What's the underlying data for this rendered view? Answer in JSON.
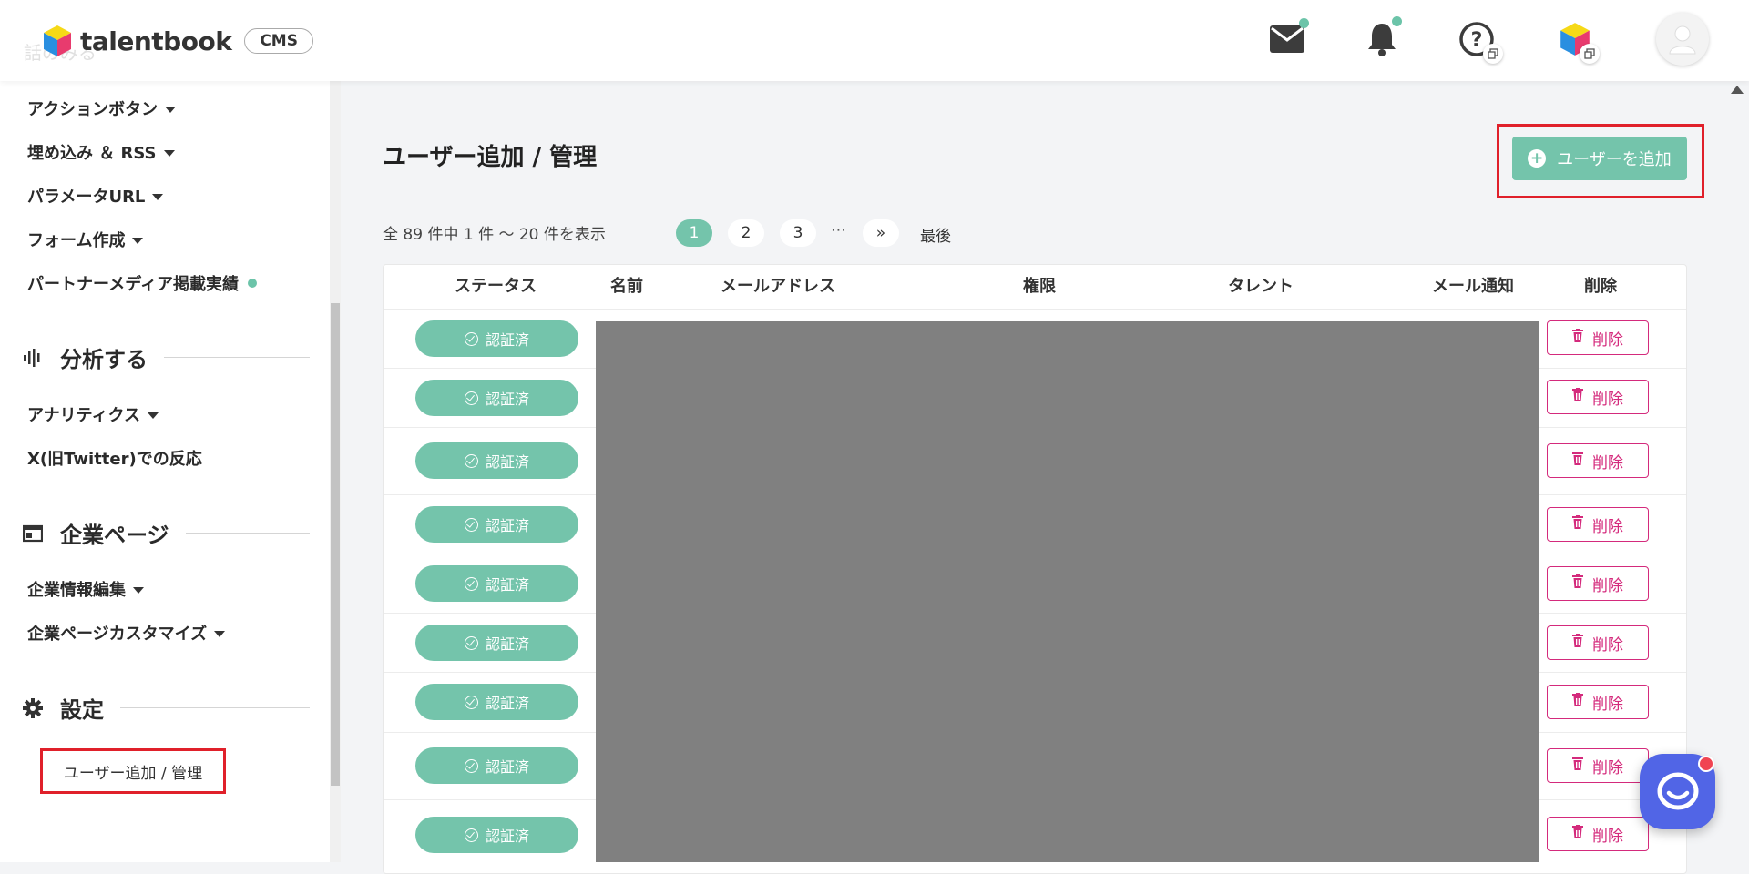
{
  "header": {
    "logo_text": "talentbook",
    "cms_badge": "CMS",
    "faded_text": "話のみる"
  },
  "sidebar": {
    "items_top": [
      {
        "label": "アクションボタン",
        "caret": true
      },
      {
        "label": "埋め込み ＆ RSS",
        "caret": true
      },
      {
        "label": "パラメータURL",
        "caret": true
      },
      {
        "label": "フォーム作成",
        "caret": true
      },
      {
        "label": "パートナーメディア掲載実績",
        "dot": true
      }
    ],
    "section_analyze": {
      "label": "分析する"
    },
    "items_analyze": [
      {
        "label": "アナリティクス",
        "caret": true
      },
      {
        "label": "X(旧Twitter)での反応"
      }
    ],
    "section_company": {
      "label": "企業ページ"
    },
    "items_company": [
      {
        "label": "企業情報編集",
        "caret": true
      },
      {
        "label": "企業ページカスタマイズ",
        "caret": true
      }
    ],
    "section_settings": {
      "label": "設定"
    },
    "active_item": {
      "label": "ユーザー追加 / 管理"
    }
  },
  "main": {
    "title": "ユーザー追加 / 管理",
    "add_button": "ユーザーを追加",
    "pager": {
      "info": "全 89 件中 1 件 〜 20 件を表示",
      "pages": [
        "1",
        "2",
        "3"
      ],
      "current": "1",
      "ellipsis": "⋯",
      "next": "»",
      "last": "最後"
    },
    "table": {
      "headers": {
        "status": "ステータス",
        "name": "名前",
        "email": "メールアドレス",
        "role": "権限",
        "talent": "タレント",
        "notify": "メール通知",
        "delete": "削除"
      },
      "rows": [
        {
          "status": "認証済",
          "delete": "削除"
        },
        {
          "status": "認証済",
          "delete": "削除"
        },
        {
          "status": "認証済",
          "delete": "削除"
        },
        {
          "status": "認証済",
          "delete": "削除"
        },
        {
          "status": "認証済",
          "delete": "削除"
        },
        {
          "status": "認証済",
          "delete": "削除"
        },
        {
          "status": "認証済",
          "delete": "削除"
        },
        {
          "status": "認証済",
          "delete": "削除"
        },
        {
          "status": "認証済",
          "delete": "削除"
        }
      ]
    }
  },
  "colors": {
    "accent": "#74c4ab",
    "delete": "#d42a7c",
    "highlight": "#e0202a",
    "chat": "#5165e6"
  }
}
